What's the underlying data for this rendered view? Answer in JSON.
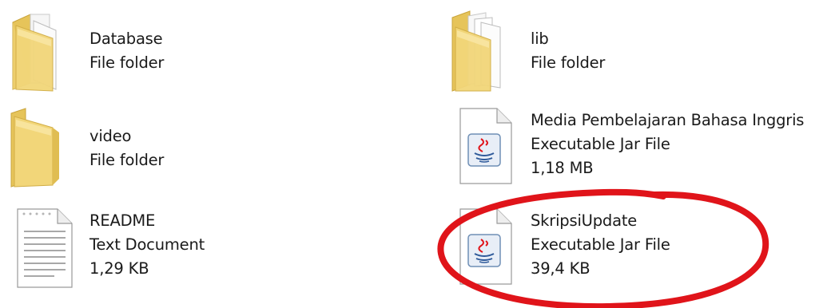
{
  "items": [
    {
      "name": "Database",
      "type": "File folder",
      "size": "",
      "icon": "folder-icon"
    },
    {
      "name": "video",
      "type": "File folder",
      "size": "",
      "icon": "folder-icon"
    },
    {
      "name": "README",
      "type": "Text Document",
      "size": "1,29 KB",
      "icon": "text-document-icon"
    },
    {
      "name": "lib",
      "type": "File folder",
      "size": "",
      "icon": "folder-icon"
    },
    {
      "name": "Media Pembelajaran Bahasa Inggris",
      "type": "Executable Jar File",
      "size": "1,18 MB",
      "icon": "java-jar-icon"
    },
    {
      "name": "SkripsiUpdate",
      "type": "Executable Jar File",
      "size": "39,4 KB",
      "icon": "java-jar-icon"
    }
  ],
  "colors": {
    "folder": "#f2d679",
    "folder_dark": "#d9b54a",
    "annotation": "#e0141a",
    "text": "#1a1a1a"
  },
  "annotation": {
    "shape": "ellipse",
    "target": "SkripsiUpdate"
  }
}
